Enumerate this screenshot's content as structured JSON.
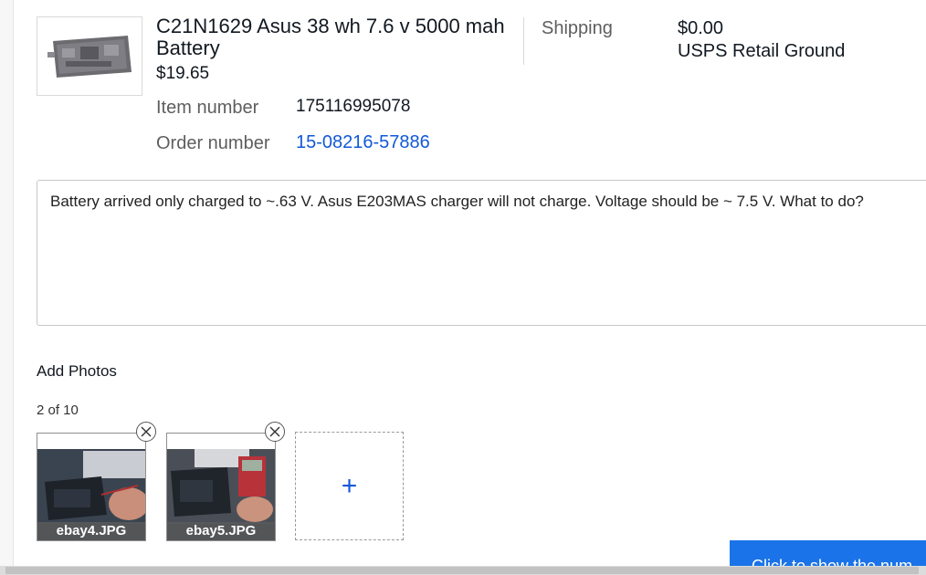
{
  "item": {
    "title": "C21N1629 Asus 38 wh 7.6 v 5000 mah Battery",
    "price": "$19.65",
    "item_number_label": "Item number",
    "item_number": "175116995078",
    "order_number_label": "Order number",
    "order_number": "15-08216-57886"
  },
  "shipping": {
    "label": "Shipping",
    "cost": "$0.00",
    "method": "USPS Retail Ground"
  },
  "comment": {
    "text": "Battery arrived only charged to ~.63 V.  Asus E203MAS  charger will not charge.  Voltage should be ~ 7.5 V.  What to do?"
  },
  "photos": {
    "heading": "Add Photos",
    "count": "2 of 10",
    "items": [
      {
        "filename": "ebay4.JPG"
      },
      {
        "filename": "ebay5.JPG"
      }
    ],
    "add_label": "+"
  },
  "footer_button": {
    "label": "Click to show the num"
  },
  "colors": {
    "link": "#1159d8",
    "button": "#1a73e8",
    "muted_text": "#5e5e5e"
  }
}
